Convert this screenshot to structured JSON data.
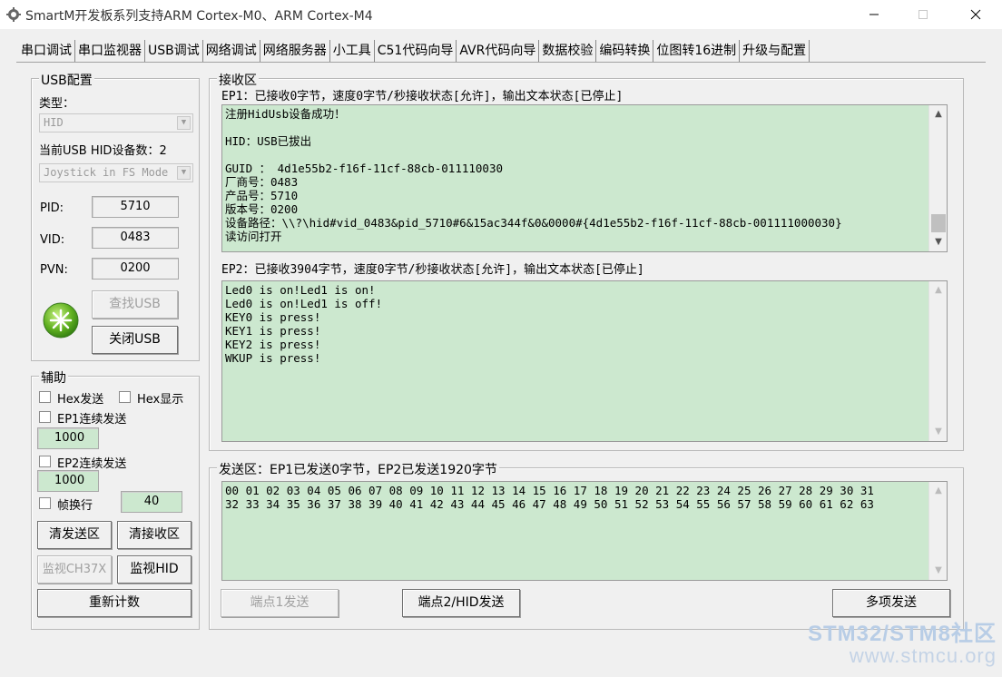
{
  "window": {
    "title": "SmartM开发板系列支持ARM Cortex-M0、ARM Cortex-M4",
    "controls": [
      "minimize-icon",
      "maximize-icon",
      "close-icon"
    ]
  },
  "tabs": [
    "串口调试",
    "串口监视器",
    "USB调试",
    "网络调试",
    "网络服务器",
    "小工具",
    "C51代码向导",
    "AVR代码向导",
    "数据校验",
    "编码转换",
    "位图转16进制",
    "升级与配置"
  ],
  "active_tab": "USB调试",
  "usb_config": {
    "title": "USB配置",
    "type_label": "类型：",
    "type_value": "HID",
    "device_count_label": "当前USB HID设备数：2",
    "device_value": "Joystick in FS Mode",
    "pid_label": "PID:",
    "pid_value": "5710",
    "vid_label": "VID:",
    "vid_value": "0483",
    "pvn_label": "PVN:",
    "pvn_value": "0200",
    "find_button": "查找USB",
    "close_button": "关闭USB"
  },
  "assist": {
    "title": "辅助",
    "hex_send": "Hex发送",
    "hex_display": "Hex显示",
    "ep1_continuous": "EP1连续发送",
    "ep1_interval": "1000",
    "ep2_continuous": "EP2连续发送",
    "ep2_interval": "1000",
    "frame_newline": "帧换行",
    "frame_value": "40",
    "clear_send": "清发送区",
    "clear_receive": "清接收区",
    "monitor_ch37x": "监视CH37X",
    "monitor_hid": "监视HID",
    "recount": "重新计数"
  },
  "receive": {
    "title": "接收区",
    "ep1_status": "EP1：已接收0字节，速度0字节/秒接收状态[允许]，输出文本状态[已停止]",
    "ep1_text": "注册HidUsb设备成功！\n\nHID：USB已拔出\n\nGUID ： 4d1e55b2-f16f-11cf-88cb-011110030\n厂商号：0483\n产品号：5710\n版本号：0200\n设备路径：\\\\?\\hid#vid_0483&pid_5710#6&15ac344f&0&0000#{4d1e55b2-f16f-11cf-88cb-001111000030}\n读访问打开",
    "ep2_status": "EP2：已接收3904字节，速度0字节/秒接收状态[允许]，输出文本状态[已停止]",
    "ep2_text": "Led0 is on!Led1 is on!\nLed0 is on!Led1 is off!\nKEY0 is press!\nKEY1 is press!\nKEY2 is press!\nWKUP is press!"
  },
  "send": {
    "title": "发送区：EP1已发送0字节，EP2已发送1920字节",
    "text": "00 01 02 03 04 05 06 07 08 09 10 11 12 13 14 15 16 17 18 19 20 21 22 23 24 25 26 27 28 29 30 31\n32 33 34 35 36 37 38 39 40 41 42 43 44 45 46 47 48 49 50 51 52 53 54 55 56 57 58 59 60 61 62 63",
    "ep1_send": "端点1发送",
    "ep2_send": "端点2/HID发送",
    "multi_send": "多项发送"
  },
  "watermark": {
    "line1": "STM32/STM8社区",
    "line2": "www.stmcu.org"
  }
}
